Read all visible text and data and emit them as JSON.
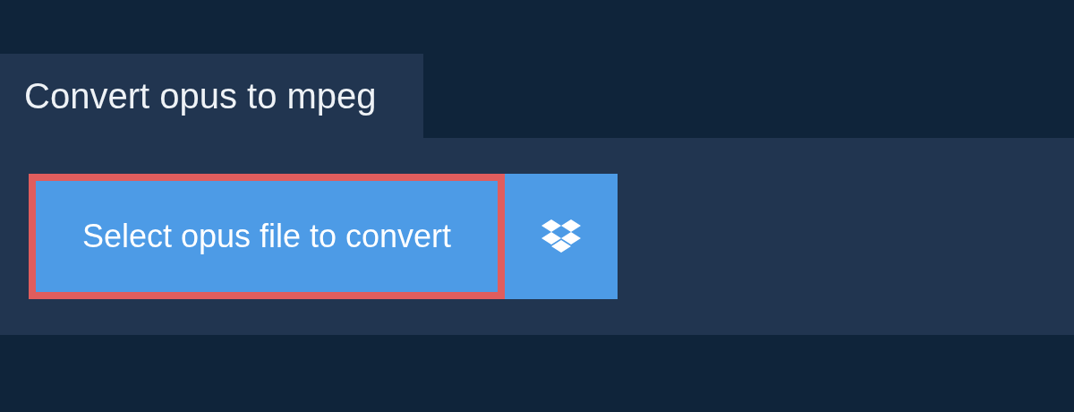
{
  "tab": {
    "title": "Convert opus to mpeg"
  },
  "select_button": {
    "label": "Select opus file to convert"
  }
}
